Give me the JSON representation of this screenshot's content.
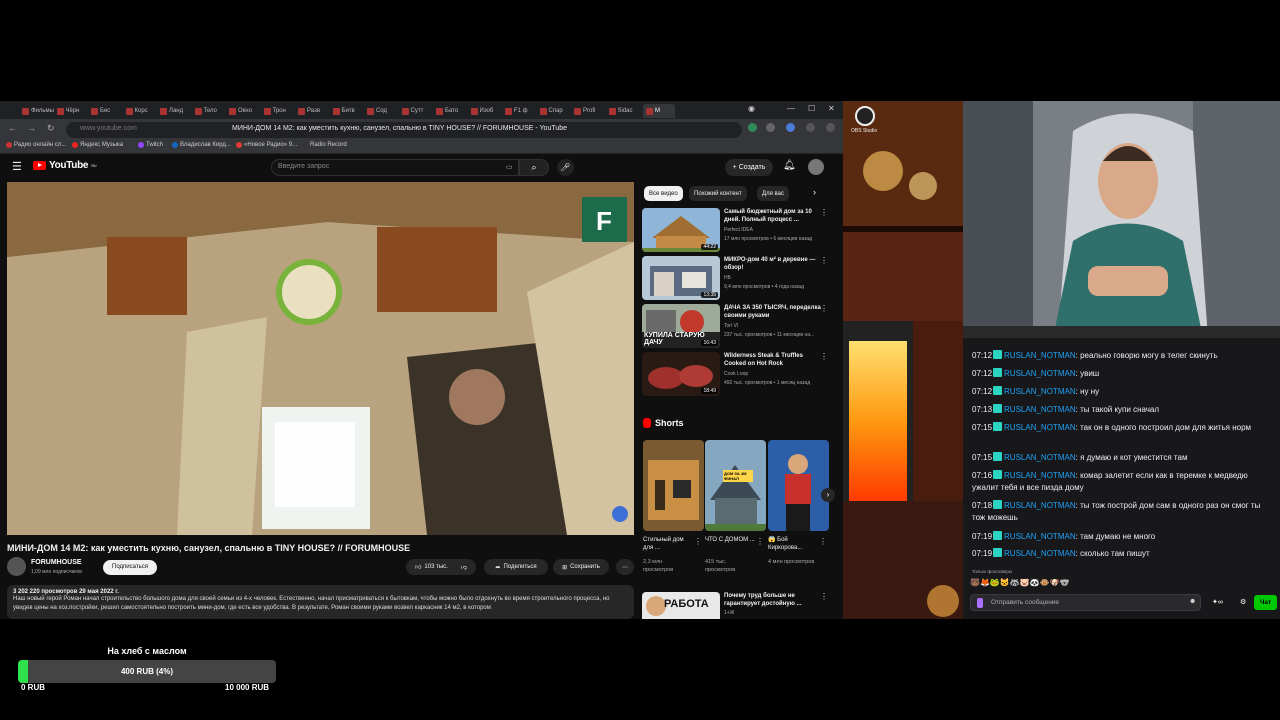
{
  "browser": {
    "tabs": [
      "Фильмы",
      "Чёрн",
      "Бес",
      "Корс",
      "Ланд",
      "Тело",
      "Окно",
      "Трон",
      "Разв",
      "Битв",
      "Сод",
      "Сутт",
      "Бато",
      "Изоб",
      "F1 ф",
      "Спар",
      "Profi",
      "Sidac",
      "М"
    ],
    "url": "www.youtube.com",
    "page_title": "МИНИ-ДОМ 14 М2: как уместить кухню, санузел, спальню в TINY HOUSE? // FORUMHOUSE - YouTube",
    "bookmarks": [
      "Радио онлайн сл...",
      "Яндекс Музыка",
      "Twitch",
      "Владислав Кирд...",
      "«Новое Радио» 9...",
      "Radio Record"
    ]
  },
  "youtube": {
    "logo": "YouTube",
    "logo_region": "RU",
    "search_placeholder": "Введите запрос",
    "create_label": "Создать",
    "video_title": "МИНИ-ДОМ 14 М2: как уместить кухню, санузел, спальню в TINY HOUSE? // FORUMHOUSE",
    "channel": "FORUMHOUSE",
    "subscribers": "1,09 млн подписчиков",
    "subscribe_label": "Подписаться",
    "likes": "103 тыс.",
    "share_label": "Поделиться",
    "save_label": "Сохранить",
    "description_meta": "3 202 220 просмотров  29 мая 2022 г.",
    "description": "Наш новый герой Роман начал строительство большого дома для своей семьи из 4-х человек. Естественно, начал присматриваться к бытовкам, чтобы можно было отдохнуть во время строительного процесса, но увидев цены на хоз.постройки, решил самостоятельно построить мини-дом, где есть все удобства. В результате, Роман своими руками возвел каркасник 14 м2, в котором",
    "chips": [
      "Все видео",
      "Похожий контент",
      "Для вас"
    ],
    "recommendations": [
      {
        "title": "Самый бюджетный дом за 10 дней. Полный процесс ...",
        "channel": "Perfect IDEA",
        "views": "17 млн просмотров • 6 месяцев назад",
        "duration": "44:22"
      },
      {
        "title": "МИКРО-дом 40 м² в деревне — обзор!",
        "channel": "НБ",
        "views": "9,4 млн просмотров • 4 года назад",
        "duration": "13:35"
      },
      {
        "title": "ДАЧА ЗА 350 ТЫСЯЧ, переделка своими руками",
        "channel": "Tori VI",
        "views": "237 тыс. просмотров • 11 месяцев на...",
        "duration": "16:43",
        "thumb_text": "КУПИЛА СТАРУЮ ДАЧУ"
      },
      {
        "title": "Wilderness Steak & Truffles Cooked on Hot Rock",
        "channel": "Cook Loop",
        "views": "492 тыс. просмотров • 1 месяц назад",
        "duration": "18:49"
      }
    ],
    "shorts_label": "Shorts",
    "shorts": [
      {
        "title": "Стильный дом для ...",
        "views": "2,3 млн просмотров"
      },
      {
        "title": "ЧТО С ДОМОМ ...",
        "views": "415 тыс. просмотров",
        "overlay": "ДОМ ЗА 4М ФИНАЛ"
      },
      {
        "title": "😱 Бой Киркорова...",
        "views": "4 млн просмотров"
      }
    ],
    "last_rec": {
      "title": "Почему труд больше не гарантирует достойную ...",
      "channel": "1+Ж",
      "thumb_text": "РАБОТА"
    },
    "watermark": "F"
  },
  "obs": {
    "label": "OBS Studio"
  },
  "chat": {
    "messages": [
      {
        "time": "07:12",
        "user": "RUSLAN_NOTMAN",
        "text": "реально говорю могу в телег скинуть"
      },
      {
        "time": "07:12",
        "user": "RUSLAN_NOTMAN",
        "text": "увиш"
      },
      {
        "time": "07:12",
        "user": "RUSLAN_NOTMAN",
        "text": "ну ну"
      },
      {
        "time": "07:13",
        "user": "RUSLAN_NOTMAN",
        "text": "ты такой купи сначал"
      },
      {
        "time": "07:15",
        "user": "RUSLAN_NOTMAN",
        "text": "так он в одного построил дом для житья норм"
      },
      {
        "time": "07:15",
        "user": "RUSLAN_NOTMAN",
        "text": "я думаю и кот уместится там"
      },
      {
        "time": "07:16",
        "user": "RUSLAN_NOTMAN",
        "text": "комар залетит если как в теремке к медведю ужалит тебя и все пизда дому"
      },
      {
        "time": "07:18",
        "user": "RUSLAN_NOTMAN",
        "text": "ты тож построй дом сам в одного раз он смог ты тож можешь"
      },
      {
        "time": "07:19",
        "user": "RUSLAN_NOTMAN",
        "text": "там думаю не много"
      },
      {
        "time": "07:19",
        "user": "RUSLAN_NOTMAN",
        "text": "сколько там пишут"
      }
    ],
    "followers_only": "Только фолловеры",
    "emotes": "🐻🦊🐸🐱🦝🐷🐼🐵🐶🐨",
    "input_placeholder": "Отправить сообщение",
    "send_label": "Чат"
  },
  "goal": {
    "title": "На хлеб с маслом",
    "progress_text": "400 RUB (4%)",
    "progress": 0.04,
    "min": "0 RUB",
    "max": "10 000 RUB"
  }
}
